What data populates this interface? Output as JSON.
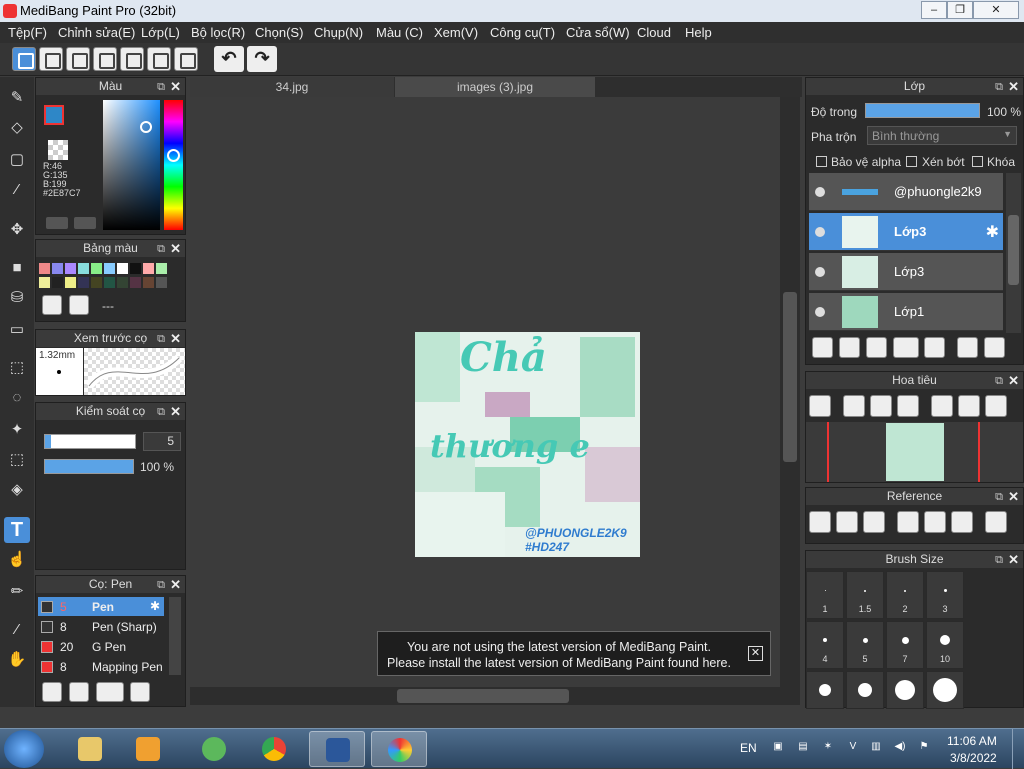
{
  "window": {
    "title": "MediBang Paint Pro (32bit)"
  },
  "menu": [
    "Tệp(F)",
    "Chỉnh sửa(E)",
    "Lớp(L)",
    "Bộ lọc(R)",
    "Chọn(S)",
    "Chụp(N)",
    "Màu (C)",
    "Xem(V)",
    "Công cụ(T)",
    "Cửa sổ(W)",
    "Cloud",
    "Help"
  ],
  "tabs": [
    "34.jpg",
    "images (3).jpg"
  ],
  "color_panel": {
    "title": "Màu",
    "r": "R:46",
    "g": "G:135",
    "b": "B:199",
    "hex": "#2E87C7",
    "fg": "#2e87c7"
  },
  "palette_panel": {
    "title": "Bảng màu",
    "empty": "---"
  },
  "brush_preview": {
    "title": "Xem trước cọ",
    "size": "1.32mm"
  },
  "brush_control": {
    "title": "Kiểm soát cọ",
    "size": "5",
    "opacity": "100 %"
  },
  "brush_list": {
    "title": "Cọ: Pen",
    "items": [
      {
        "size": "5",
        "name": "Pen",
        "color": "#333"
      },
      {
        "size": "8",
        "name": "Pen (Sharp)",
        "color": "#333"
      },
      {
        "size": "20",
        "name": "G Pen",
        "color": "#e33"
      },
      {
        "size": "8",
        "name": "Mapping Pen",
        "color": "#e33"
      }
    ]
  },
  "layer_panel": {
    "title": "Lớp",
    "opacity_label": "Độ trong",
    "opacity_value": "100 %",
    "blend_label": "Pha trộn",
    "blend_value": "Bình thường",
    "protect_alpha": "Bảo vệ alpha",
    "clipping": "Xén bớt",
    "lock": "Khóa",
    "layers": [
      "@phuongle2k9",
      "Lớp3",
      "Lớp3",
      "Lớp1"
    ]
  },
  "navigator": {
    "title": "Hoa tiêu"
  },
  "reference": {
    "title": "Reference"
  },
  "brush_size": {
    "title": "Brush Size",
    "sizes": [
      "1",
      "1.5",
      "2",
      "3",
      "4",
      "5",
      "7",
      "10",
      "",
      "",
      "",
      ""
    ]
  },
  "notice": {
    "line1": "You are not using the latest version of MediBang Paint.",
    "line2": "Please install the latest version of MediBang Paint found here."
  },
  "artwork": {
    "title": "Chả",
    "subtitle": "thương e",
    "credit": "@PHUONGLE2K9",
    "tag": "#HD247"
  },
  "taskbar": {
    "lang": "EN",
    "time": "11:06 AM",
    "date": "3/8/2022"
  }
}
